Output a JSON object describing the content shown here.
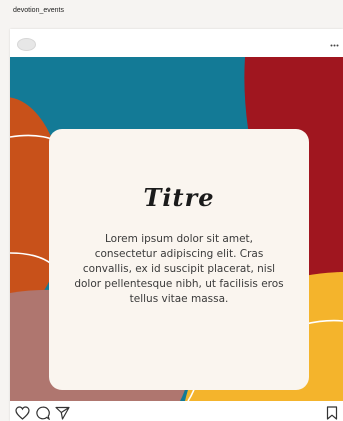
{
  "header": {
    "account_name": "devotion_events"
  },
  "post": {
    "card": {
      "title": "Titre",
      "body": "Lorem ipsum dolor sit amet, consectetur adipiscing elit. Cras convallis, ex id suscipit placerat, nisl dolor pellentesque nibh, ut facilisis eros tellus vitae massa."
    },
    "icons": {
      "avatar": "avatar-icon",
      "more": "more-options-icon",
      "like": "heart-icon",
      "comment": "comment-bubble-icon",
      "share": "send-paper-plane-icon",
      "save": "bookmark-icon"
    }
  },
  "colors": {
    "teal": "#137a96",
    "red": "#a0161f",
    "orange": "#c8511a",
    "mauve": "#af766f",
    "yellow": "#f4b42c",
    "card": "#faf5ef"
  }
}
